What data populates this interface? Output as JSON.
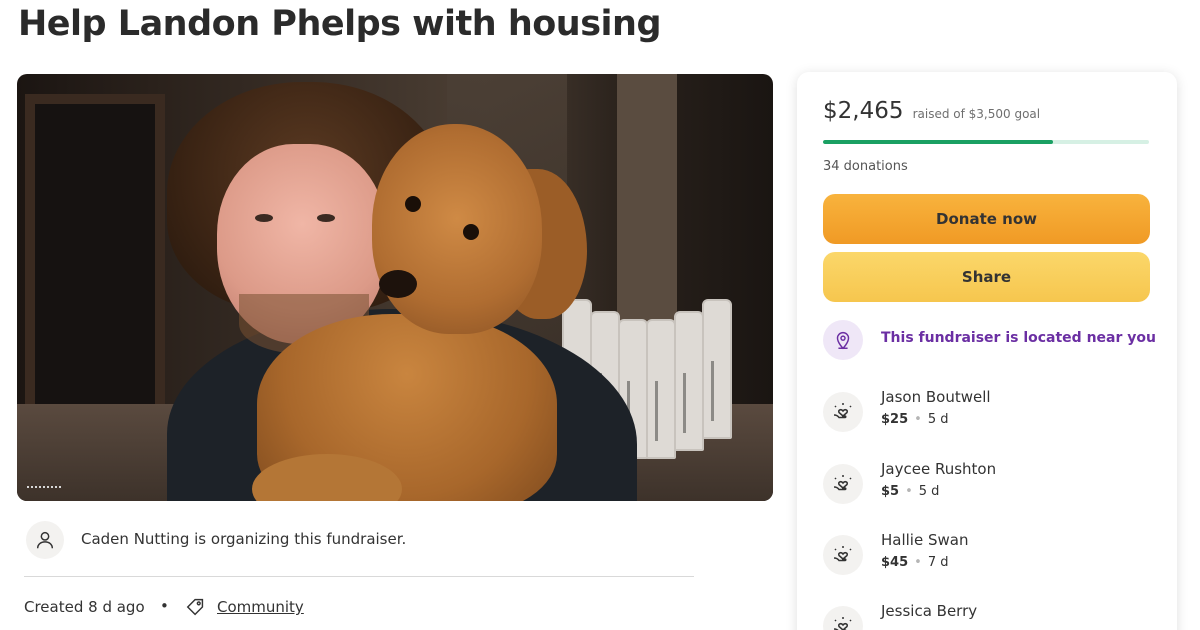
{
  "page_title": "Help Landon Phelps with housing",
  "organizer": {
    "text": "Caden Nutting is organizing this fundraiser.",
    "icon": "user-icon"
  },
  "meta": {
    "created": "Created 8 d ago",
    "separator": "•",
    "category": "Community",
    "category_icon": "tag-icon"
  },
  "donation_card": {
    "raised_amount": "$2,465",
    "goal_text": "raised of $3,500 goal",
    "progress_fraction": 0.704,
    "donations_count": "34 donations",
    "donate_button": "Donate now",
    "share_button": "Share",
    "location_text": "This fundraiser is located near you",
    "location_icon": "location-pin-icon"
  },
  "donors": [
    {
      "name": "Jason Boutwell",
      "amount": "$25",
      "time": "5 d"
    },
    {
      "name": "Jaycee Rushton",
      "amount": "$5",
      "time": "5 d"
    },
    {
      "name": "Hallie Swan",
      "amount": "$45",
      "time": "7 d"
    },
    {
      "name": "Jessica Berry",
      "amount": "",
      "time": ""
    }
  ],
  "colors": {
    "progress_fill": "#1aa063",
    "donate_button": "#f3a52e",
    "share_button": "#f8cf5c",
    "location_text": "#6b2fa3"
  }
}
